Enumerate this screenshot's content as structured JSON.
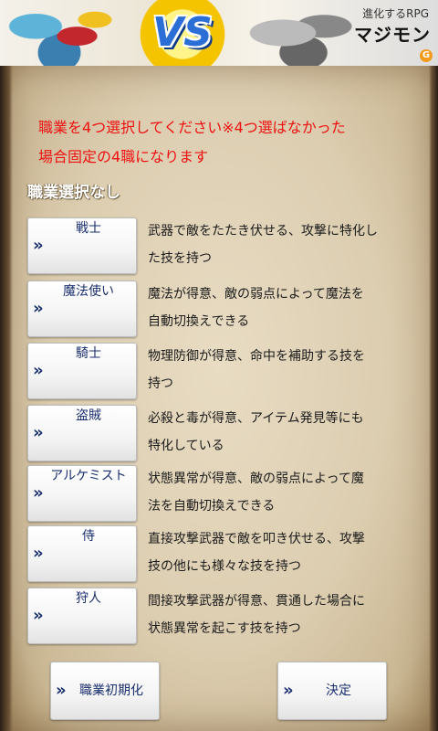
{
  "ad": {
    "vs_text": "VS",
    "subtitle": "進化するRPG",
    "title": "マジモン",
    "badge": "G"
  },
  "notice": {
    "line1": "職業を4つ選択してください※4つ選ばなかった",
    "line2": "場合固定の4職になります"
  },
  "status": "職業選択なし",
  "jobs": [
    {
      "label": "戦士",
      "desc1": "武器で敵をたたき伏せる、攻撃に特化し",
      "desc2": "た技を持つ"
    },
    {
      "label": "魔法使い",
      "desc1": "魔法が得意、敵の弱点によって魔法を",
      "desc2": "自動切換えできる"
    },
    {
      "label": "騎士",
      "desc1": "物理防御が得意、命中を補助する技を",
      "desc2": "持つ"
    },
    {
      "label": "盗賊",
      "desc1": "必殺と毒が得意、アイテム発見等にも",
      "desc2": "特化している"
    },
    {
      "label": "アルケミスト",
      "desc1": "状態異常が得意、敵の弱点によって魔",
      "desc2": "法を自動切換えできる"
    },
    {
      "label": "侍",
      "desc1": "直接攻撃武器で敵を叩き伏せる、攻撃",
      "desc2": "技の他にも様々な技を持つ"
    },
    {
      "label": "狩人",
      "desc1": "間接攻撃武器が得意、貫通した場合に",
      "desc2": "状態異常を起こす技を持つ"
    }
  ],
  "buttons": {
    "reset": "職業初期化",
    "confirm": "決定"
  },
  "icons": {
    "chevron": "»"
  },
  "colors": {
    "notice": "#ee1111",
    "button_text": "#1a2f6e",
    "parchment": "#dccdb0"
  }
}
